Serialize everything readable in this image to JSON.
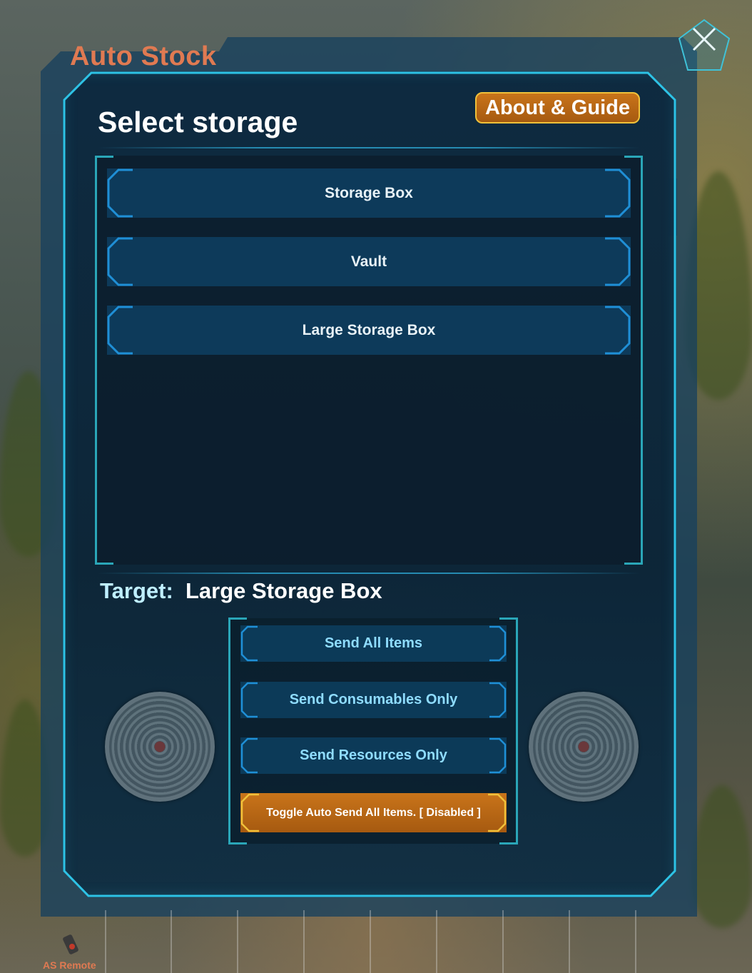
{
  "app": {
    "title": "Auto Stock"
  },
  "header": {
    "heading": "Select storage",
    "about_label": "About & Guide"
  },
  "storage_list": {
    "items": [
      {
        "label": "Storage Box"
      },
      {
        "label": "Vault"
      },
      {
        "label": "Large Storage Box"
      }
    ]
  },
  "target": {
    "prefix": "Target:",
    "value": "Large Storage Box"
  },
  "actions": {
    "send_all": "Send All Items",
    "send_consumables": "Send Consumables Only",
    "send_resources": "Send Resources Only",
    "toggle_auto": "Toggle Auto Send All Items. [ Disabled ]"
  },
  "hotbar": {
    "slot_1_label": "AS Remote"
  },
  "icons": {
    "close": "close-icon",
    "medallion": "medallion-icon",
    "remote": "remote-icon"
  },
  "colors": {
    "title_accent": "#e07a52",
    "frame_cyan": "#24b7d9",
    "button_blue": "#0c3a58",
    "button_orange": "#b8661a",
    "button_orange_border": "#f0c13a"
  }
}
